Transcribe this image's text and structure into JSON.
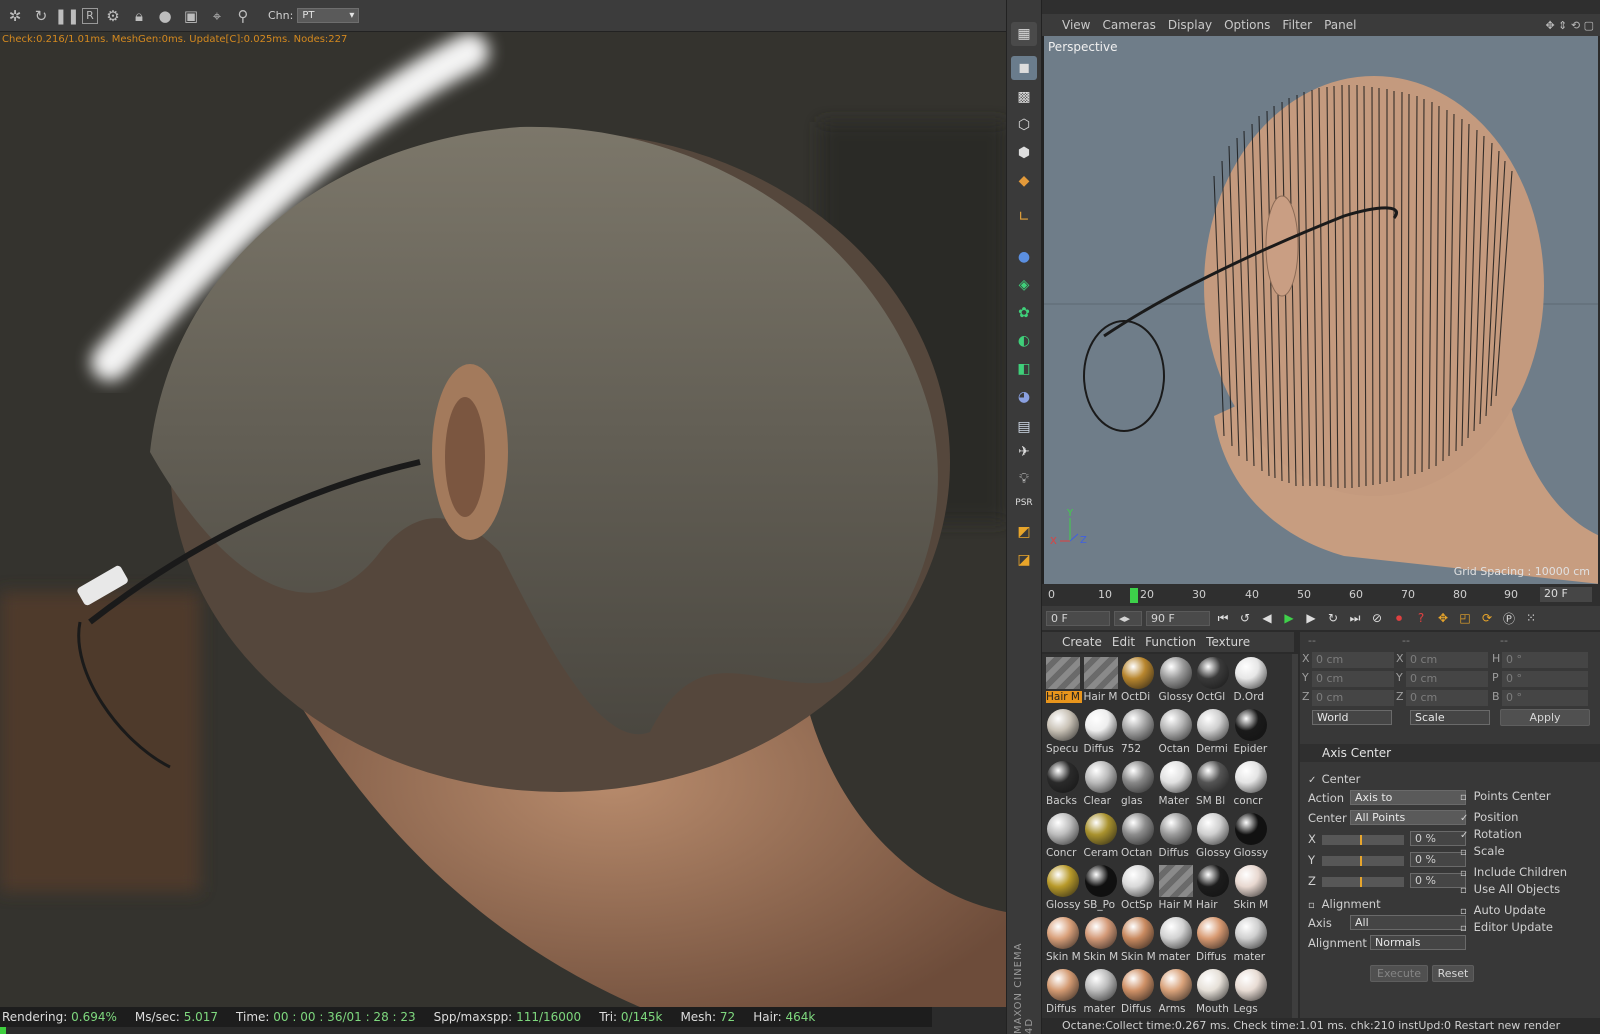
{
  "render_window": {
    "channel_label": "Chn:",
    "channel_value": "PT",
    "top_stats": "Check:0.216/1.01ms. MeshGen:0ms. Update[C]:0.025ms. Nodes:227",
    "status": [
      {
        "label": "Rendering:",
        "value": "0.694%"
      },
      {
        "label": "Ms/sec:",
        "value": "5.017"
      },
      {
        "label": "Time:",
        "value": "00 : 00 : 36/01 : 28 : 23"
      },
      {
        "label": "Spp/maxspp:",
        "value": "111/16000"
      },
      {
        "label": "Tri:",
        "value": "0/145k"
      },
      {
        "label": "Mesh:",
        "value": "72"
      },
      {
        "label": "Hair:",
        "value": "464k"
      }
    ],
    "progress": 0.00694
  },
  "viewport": {
    "menu": [
      "View",
      "Cameras",
      "Display",
      "Options",
      "Filter",
      "Panel"
    ],
    "label": "Perspective",
    "grid_spacing": "Grid Spacing : 10000 cm"
  },
  "timeline": {
    "ticks": [
      "0",
      "10",
      "20",
      "30",
      "40",
      "50",
      "60",
      "70",
      "80",
      "90"
    ],
    "current_frame": 20,
    "frame_field": "20 F",
    "start_field": "0 F",
    "end_field": "90 F"
  },
  "materials": {
    "menu": [
      "Create",
      "Edit",
      "Function",
      "Texture"
    ],
    "items": [
      {
        "label": "Hair M",
        "color": "#777777",
        "style": "stripe",
        "selected": true
      },
      {
        "label": "Hair M",
        "color": "#777777",
        "style": "stripe"
      },
      {
        "label": "OctDi",
        "color": "#b8862e",
        "style": "dark"
      },
      {
        "label": "Glossy",
        "color": "#9a9a9a"
      },
      {
        "label": "OctGl",
        "color": "#3a3a3a"
      },
      {
        "label": "D.Ord",
        "color": "#e6e6e6"
      },
      {
        "label": "Specu",
        "color": "#c9c2b6"
      },
      {
        "label": "Diffus",
        "color": "#eeeeee"
      },
      {
        "label": "752",
        "color": "#a6a6a6"
      },
      {
        "label": "Octan",
        "color": "#b5b5b5"
      },
      {
        "label": "Dermi",
        "color": "#cfcfcf"
      },
      {
        "label": "Epider",
        "color": "#1a1a1a"
      },
      {
        "label": "Backs",
        "color": "#2a2a2a"
      },
      {
        "label": "Clear",
        "color": "#bbbbbb"
      },
      {
        "label": "glas",
        "color": "#888888"
      },
      {
        "label": "Mater",
        "color": "#e0e0e0"
      },
      {
        "label": "SM Bl",
        "color": "#555555"
      },
      {
        "label": "concr",
        "color": "#e4e4e4"
      },
      {
        "label": "Concr",
        "color": "#bdbdbd"
      },
      {
        "label": "Ceram",
        "color": "#a9922e"
      },
      {
        "label": "Octan",
        "color": "#8c8c8c"
      },
      {
        "label": "Diffus",
        "color": "#9b9b9b"
      },
      {
        "label": "Glossy",
        "color": "#cfcfcf"
      },
      {
        "label": "Glossy",
        "color": "#111111"
      },
      {
        "label": "Glossy",
        "color": "#b89a2a"
      },
      {
        "label": "SB_Po",
        "color": "#101010"
      },
      {
        "label": "OctSp",
        "color": "#d9d9d9"
      },
      {
        "label": "Hair M",
        "color": "#777777",
        "style": "stripe"
      },
      {
        "label": "Hair",
        "color": "#1c1c1c"
      },
      {
        "label": "Skin M",
        "color": "#e8d8d0"
      },
      {
        "label": "Skin M",
        "color": "#d9a07a"
      },
      {
        "label": "Skin M",
        "color": "#d49a78"
      },
      {
        "label": "Skin M",
        "color": "#c98a60"
      },
      {
        "label": "mater",
        "color": "#d2d2d2"
      },
      {
        "label": "Diffus",
        "color": "#d89a72"
      },
      {
        "label": "mater",
        "color": "#cfcfcf"
      },
      {
        "label": "Diffus",
        "color": "#d39a72"
      },
      {
        "label": "mater",
        "color": "#bcbcbc"
      },
      {
        "label": "Diffus",
        "color": "#cf9167"
      },
      {
        "label": "Arms",
        "color": "#d9a27a"
      },
      {
        "label": "Mouth",
        "color": "#e6e0d8"
      },
      {
        "label": "Legs",
        "color": "#e8dcd4"
      }
    ]
  },
  "coordinates": {
    "pos": [
      {
        "axis": "X",
        "value": "0 cm"
      },
      {
        "axis": "Y",
        "value": "0 cm"
      },
      {
        "axis": "Z",
        "value": "0 cm"
      }
    ],
    "size": [
      {
        "axis": "X",
        "value": "0 cm"
      },
      {
        "axis": "Y",
        "value": "0 cm"
      },
      {
        "axis": "Z",
        "value": "0 cm"
      }
    ],
    "rot": [
      {
        "axis": "H",
        "value": "0 °"
      },
      {
        "axis": "P",
        "value": "0 °"
      },
      {
        "axis": "B",
        "value": "0 °"
      }
    ],
    "world": "World",
    "scale": "Scale",
    "apply": "Apply",
    "dash1": "--",
    "dash2": "--",
    "dash3": "--"
  },
  "axis_center": {
    "title": "Axis Center",
    "center_label": "Center",
    "action_label": "Action",
    "action_value": "Axis to",
    "center_field_label": "Center",
    "center_value": "All Points",
    "xyz": [
      {
        "axis": "X",
        "value": "0 %"
      },
      {
        "axis": "Y",
        "value": "0 %"
      },
      {
        "axis": "Z",
        "value": "0 %"
      }
    ],
    "alignment_label": "Alignment",
    "axis_label": "Axis",
    "axis_value": "All",
    "alignment_field_label": "Alignment",
    "alignment_value": "Normals",
    "points_center": "Points Center",
    "position": "Position",
    "rotation": "Rotation",
    "scale": "Scale",
    "include_children": "Include Children",
    "use_all_objects": "Use All Objects",
    "auto_update": "Auto Update",
    "editor_update": "Editor Update",
    "execute": "Execute",
    "reset": "Reset"
  },
  "brand": "MAXON CINEMA 4D",
  "bottom_status": "Octane:Collect time:0.267 ms.  Check time:1.01 ms.  chk:210  instUpd:0      Restart new render"
}
